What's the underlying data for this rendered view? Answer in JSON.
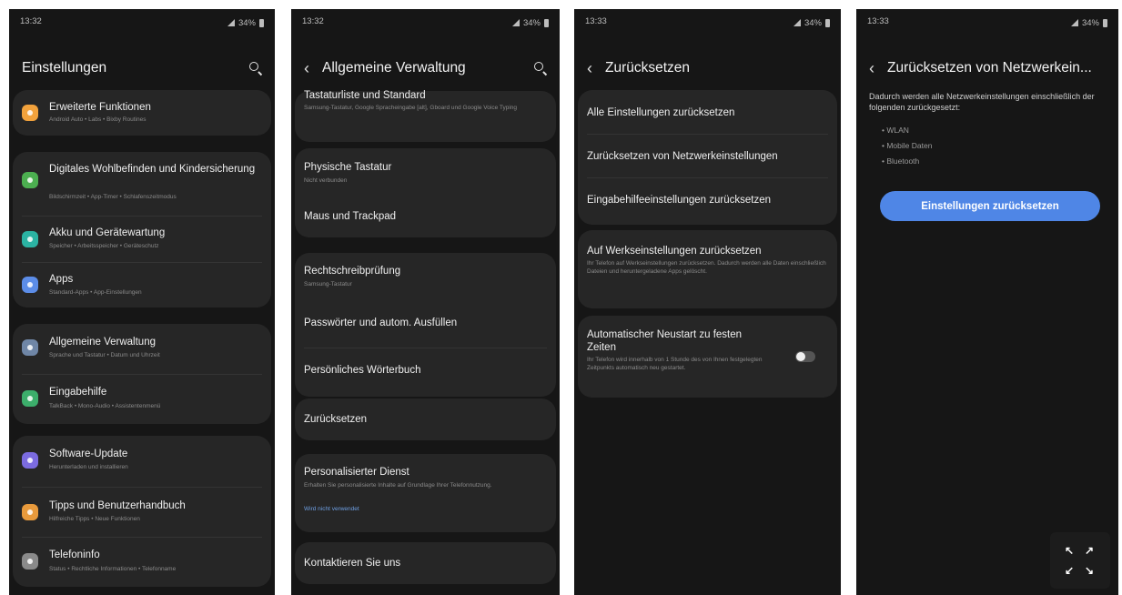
{
  "screens": [
    {
      "status": {
        "time": "13:32",
        "battery": "34%"
      },
      "title": "Einstellungen",
      "items": [
        {
          "title": "Erweiterte Funktionen",
          "subtitle": "Android Auto • Labs • Bixby Routines",
          "icon": "star-icon",
          "color": "#f2a23c"
        },
        {
          "title": "Digitales Wohlbefinden und Kindersicherung",
          "subtitle": "Bildschirmzeit • App-Timer • Schlafenszeitmodus",
          "icon": "wellbeing-icon",
          "color": "#4caf50"
        },
        {
          "title": "Akku und Gerätewartung",
          "subtitle": "Speicher • Arbeitsspeicher • Geräteschutz",
          "icon": "battery-care-icon",
          "color": "#2bb3a3"
        },
        {
          "title": "Apps",
          "subtitle": "Standard-Apps • App-Einstellungen",
          "icon": "apps-icon",
          "color": "#5c8de8"
        },
        {
          "title": "Allgemeine Verwaltung",
          "subtitle": "Sprache und Tastatur • Datum und Uhrzeit",
          "icon": "sliders-icon",
          "color": "#6f86a6"
        },
        {
          "title": "Eingabehilfe",
          "subtitle": "TalkBack • Mono-Audio • Assistentenmenü",
          "icon": "accessibility-icon",
          "color": "#3cae6b"
        },
        {
          "title": "Software-Update",
          "subtitle": "Herunterladen und installieren",
          "icon": "update-icon",
          "color": "#7b6be0"
        },
        {
          "title": "Tipps und Benutzerhandbuch",
          "subtitle": "Hilfreiche Tipps • Neue Funktionen",
          "icon": "lightbulb-icon",
          "color": "#e89a3c"
        },
        {
          "title": "Telefoninfo",
          "subtitle": "Status • Rechtliche Informationen • Telefonname",
          "icon": "info-icon",
          "color": "#8a8a8a"
        }
      ]
    },
    {
      "status": {
        "time": "13:32",
        "battery": "34%"
      },
      "title": "Allgemeine Verwaltung",
      "items": [
        {
          "title": "Tastaturliste und Standard",
          "subtitle": "Samsung-Tastatur, Google Spracheingabe [alt], Gboard und Google Voice Typing"
        },
        {
          "title": "Physische Tastatur",
          "subtitle": "Nicht verbunden"
        },
        {
          "title": "Maus und Trackpad",
          "subtitle": ""
        },
        {
          "title": "Rechtschreibprüfung",
          "subtitle": "Samsung-Tastatur"
        },
        {
          "title": "Passwörter und autom. Ausfüllen",
          "subtitle": ""
        },
        {
          "title": "Persönliches Wörterbuch",
          "subtitle": ""
        },
        {
          "title": "Zurücksetzen",
          "subtitle": ""
        },
        {
          "title": "Personalisierter Dienst",
          "subtitle": "Erhalten Sie personalisierte Inhalte auf Grundlage Ihrer Telefonnutzung.",
          "link": "Wird nicht verwendet"
        },
        {
          "title": "Kontaktieren Sie uns",
          "subtitle": ""
        }
      ]
    },
    {
      "status": {
        "time": "13:33",
        "battery": "34%"
      },
      "title": "Zurücksetzen",
      "items": [
        {
          "title": "Alle Einstellungen zurücksetzen",
          "subtitle": ""
        },
        {
          "title": "Zurücksetzen von Netzwerkeinstellungen",
          "subtitle": ""
        },
        {
          "title": "Eingabehilfeeinstellungen zurücksetzen",
          "subtitle": ""
        },
        {
          "title": "Auf Werkseinstellungen zurücksetzen",
          "subtitle": "Ihr Telefon auf Werkseinstellungen zurücksetzen. Dadurch werden alle Daten einschließlich Dateien und heruntergeladene Apps gelöscht."
        },
        {
          "title": "Automatischer Neustart zu festen Zeiten",
          "subtitle": "Ihr Telefon wird innerhalb von 1 Stunde des von Ihnen festgelegten Zeitpunkts automatisch neu gestartet.",
          "toggle": "off"
        }
      ]
    },
    {
      "status": {
        "time": "13:33",
        "battery": "34%"
      },
      "title": "Zurücksetzen von Netzwerkein...",
      "description": "Dadurch werden alle Netzwerkeinstellungen einschließlich der folgenden zurückgesetzt:",
      "bullets": [
        "• WLAN",
        "• Mobile Daten",
        "• Bluetooth"
      ],
      "button": "Einstellungen zurücksetzen"
    }
  ]
}
